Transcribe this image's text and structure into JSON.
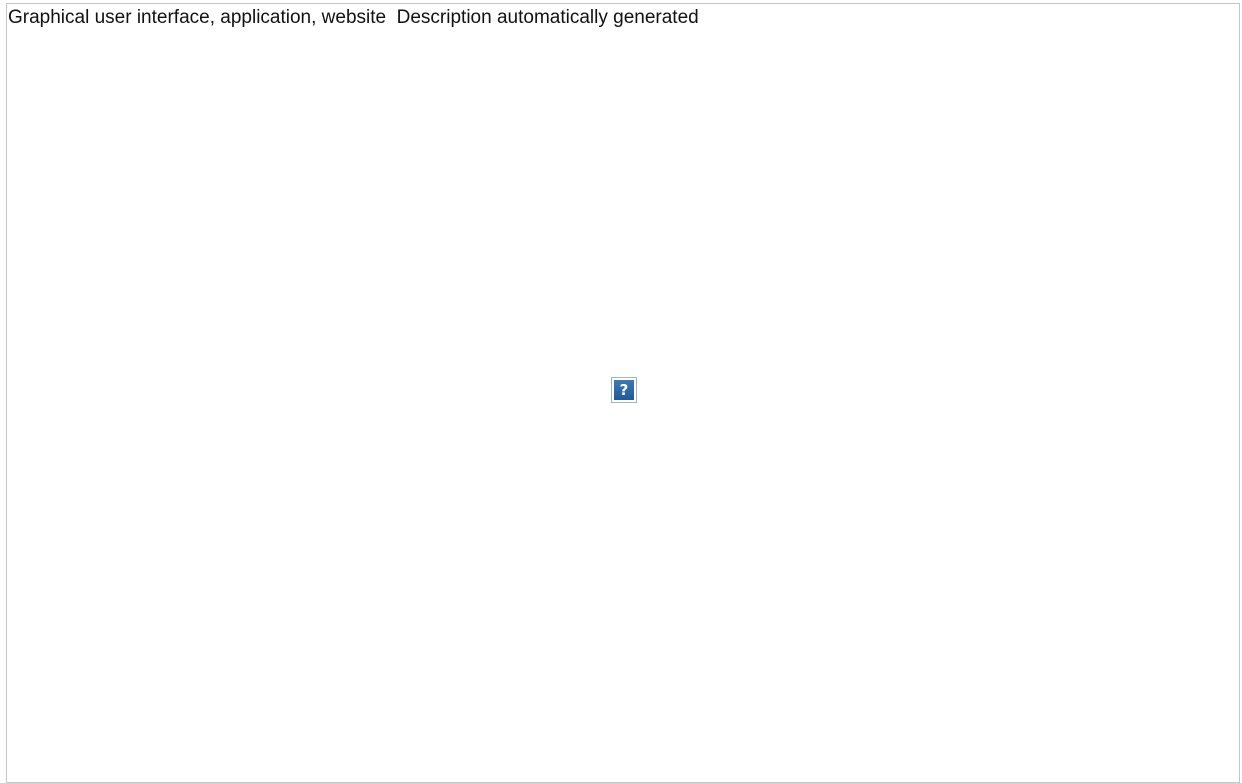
{
  "image_placeholder": {
    "alt_text": "Graphical user interface, application, website  Description automatically generated",
    "icon": "broken-image-question-icon",
    "icon_glyph": "?",
    "icon_color": "#2a67a8",
    "border_color": "#c6c6c6"
  }
}
